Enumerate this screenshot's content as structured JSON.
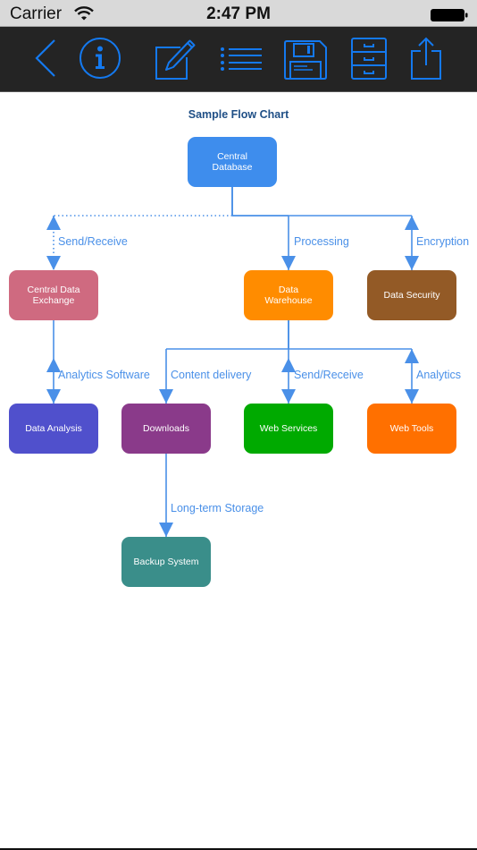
{
  "status_bar": {
    "carrier": "Carrier",
    "time": "2:47 PM",
    "wifi_icon": "wifi-icon",
    "battery_icon": "battery-full-icon"
  },
  "toolbar": {
    "accent_color": "#1479ef",
    "buttons": [
      {
        "name": "back",
        "icon": "chevron-left-icon"
      },
      {
        "name": "info",
        "icon": "info-circle-icon"
      },
      {
        "name": "edit",
        "icon": "compose-pencil-icon"
      },
      {
        "name": "list",
        "icon": "list-icon"
      },
      {
        "name": "save",
        "icon": "floppy-disk-icon"
      },
      {
        "name": "cabinet",
        "icon": "file-cabinet-icon"
      },
      {
        "name": "share",
        "icon": "share-icon"
      }
    ]
  },
  "diagram": {
    "title": "Sample Flow Chart",
    "edge_color": "#4a90e8",
    "nodes": [
      {
        "id": "central-database",
        "label": "Central\nDatabase",
        "color": "#3e8ded"
      },
      {
        "id": "central-data-exchange",
        "label": "Central Data\nExchange",
        "color": "#cf6a80"
      },
      {
        "id": "data-warehouse",
        "label": "Data\nWarehouse",
        "color": "#ff8c00"
      },
      {
        "id": "data-security",
        "label": "Data Security",
        "color": "#935a26"
      },
      {
        "id": "data-analysis",
        "label": "Data Analysis",
        "color": "#5050cc"
      },
      {
        "id": "downloads",
        "label": "Downloads",
        "color": "#8a3a8a"
      },
      {
        "id": "web-services",
        "label": "Web Services",
        "color": "#00aa00"
      },
      {
        "id": "web-tools",
        "label": "Web Tools",
        "color": "#ff7000"
      },
      {
        "id": "backup-system",
        "label": "Backup System",
        "color": "#3a8e8a"
      }
    ],
    "edges": [
      {
        "from": "central-database",
        "to": "central-data-exchange",
        "label": "Send/Receive",
        "style": "dotted",
        "direction": "both"
      },
      {
        "from": "central-database",
        "to": "data-warehouse",
        "label": "Processing",
        "style": "solid",
        "direction": "forward"
      },
      {
        "from": "central-database",
        "to": "data-security",
        "label": "Encryption",
        "style": "solid",
        "direction": "both"
      },
      {
        "from": "central-data-exchange",
        "to": "data-analysis",
        "label": "Analytics Software",
        "style": "solid",
        "direction": "both"
      },
      {
        "from": "data-warehouse",
        "to": "downloads",
        "label": "Content delivery",
        "style": "solid",
        "direction": "forward"
      },
      {
        "from": "data-warehouse",
        "to": "web-services",
        "label": "Send/Receive",
        "style": "solid",
        "direction": "both"
      },
      {
        "from": "data-warehouse",
        "to": "web-tools",
        "label": "Analytics",
        "style": "solid",
        "direction": "both"
      },
      {
        "from": "downloads",
        "to": "backup-system",
        "label": "Long-term Storage",
        "style": "solid",
        "direction": "forward"
      }
    ]
  }
}
